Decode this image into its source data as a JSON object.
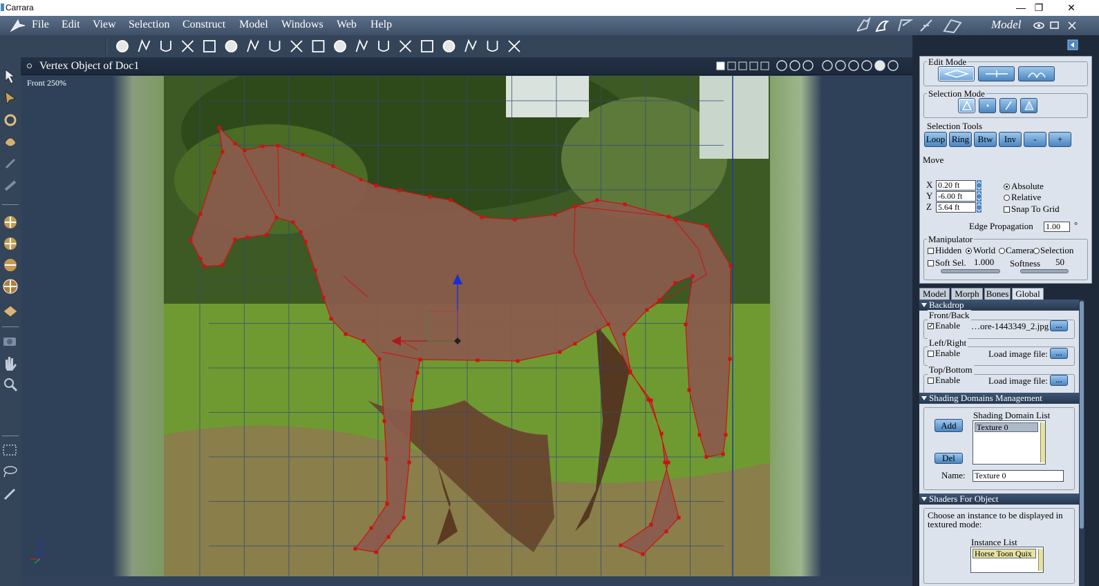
{
  "app": {
    "title": "Carrara",
    "room": "Model"
  },
  "window_controls": {
    "minimize": "—",
    "maximize": "❐",
    "close": "✕"
  },
  "menu": [
    "File",
    "Edit",
    "View",
    "Selection",
    "Construct",
    "Model",
    "Windows",
    "Web",
    "Help"
  ],
  "toolbar": {
    "tools": [
      "sphere-primitive-icon",
      "spline-modeler-icon",
      "magnet-icon",
      "scissors-icon",
      "knife-icon",
      "bevel-icon",
      "dome-icon",
      "lathe-icon",
      "extrude-icon",
      "goblet-icon",
      "box-frame-icon",
      "cube-icon",
      "package-icon",
      "light-icon",
      "wand-icon",
      "puppet-icon",
      "camera-icon",
      "render-icon",
      "brush-icon"
    ]
  },
  "document": {
    "title": "Vertex Object of Doc1",
    "view_label": "Front 250%"
  },
  "edit_mode": {
    "title": "Edit Mode"
  },
  "selection_mode": {
    "title": "Selection Mode"
  },
  "selection_tools": {
    "title": "Selection Tools",
    "buttons": [
      "Loop",
      "Ring",
      "Btw",
      "Inv",
      "-",
      "+"
    ]
  },
  "move": {
    "title": "Move",
    "x_label": "X",
    "x": "0.20 ft",
    "y_label": "Y",
    "y": "-6.00 ft",
    "z_label": "Z",
    "z": "5.64 ft",
    "absolute": "Absolute",
    "relative": "Relative",
    "snap": "Snap To Grid",
    "edge_propagation_label": "Edge Propagation",
    "edge_propagation": "1.00",
    "degree": "°"
  },
  "manipulator": {
    "title": "Manipulator",
    "hidden": "Hidden",
    "world": "World",
    "camera": "Camera",
    "selection": "Selection",
    "soft_sel": "Soft Sel.",
    "soft_val": "1.000",
    "softness": "Softness",
    "softness_val": "50"
  },
  "tabs": [
    "Model",
    "Morph",
    "Bones",
    "Global"
  ],
  "backdrop": {
    "title": "Backdrop",
    "front_back": "Front/Back",
    "enable": "Enable",
    "front_file": "…ore-1443349_2.jpg",
    "left_right": "Left/Right",
    "top_bottom": "Top/Bottom",
    "load_image": "Load image file:",
    "browse": "..."
  },
  "shading": {
    "title": "Shading Domains Management",
    "add": "Add",
    "del": "Del",
    "list_title": "Shading Domain List",
    "list_item": "Texture 0",
    "name_label": "Name:",
    "name_value": "Texture 0"
  },
  "shaders": {
    "title": "Shaders For Object",
    "desc": "Choose an instance to be displayed in textured mode:",
    "instance_title": "Instance List",
    "instance_item": "Horse Toon Quix"
  },
  "colors": {
    "mesh_fill": "#8a5a4c",
    "mesh_edge": "#d01010",
    "accent": "#4a86c2"
  }
}
